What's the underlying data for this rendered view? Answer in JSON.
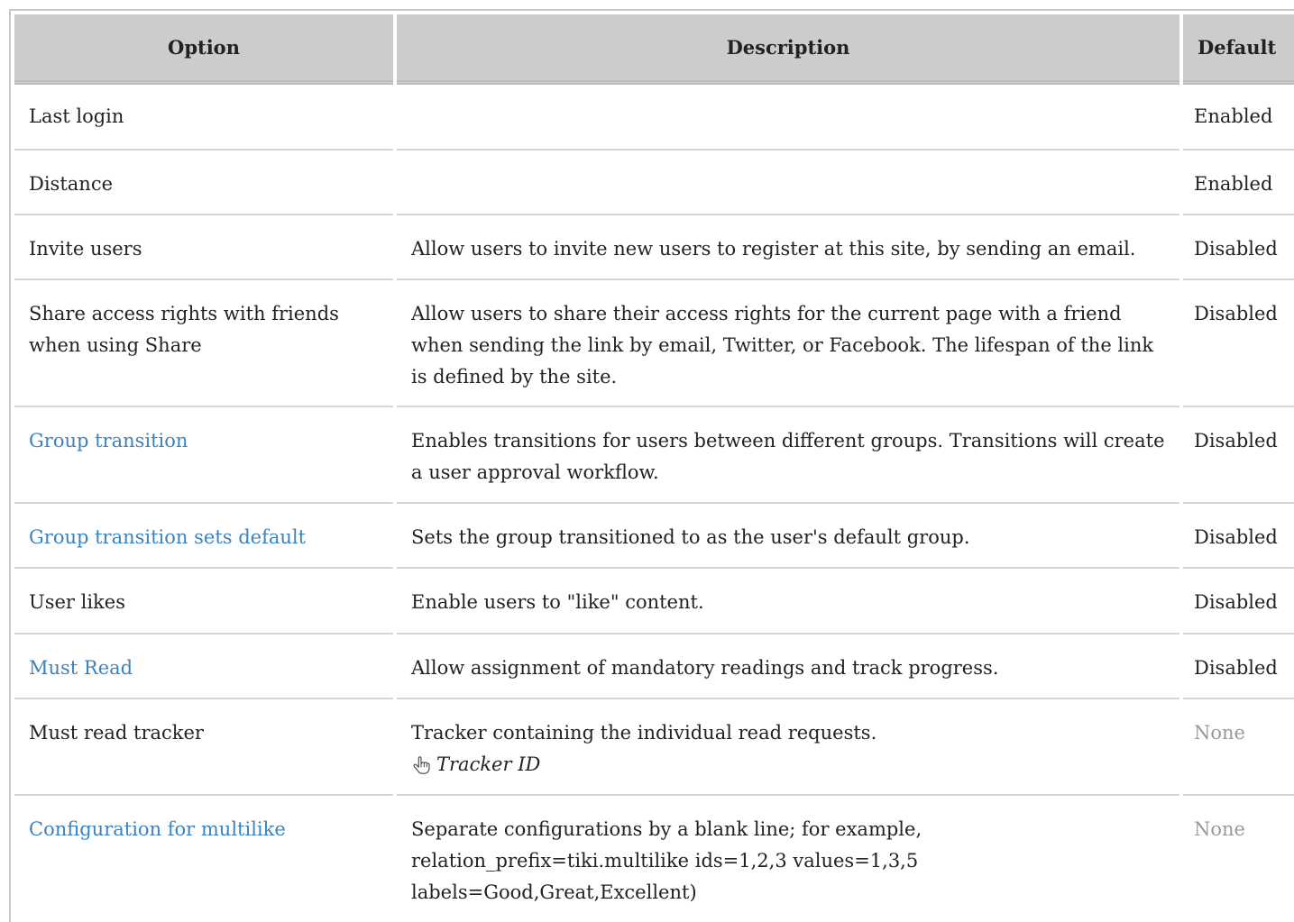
{
  "table": {
    "headers": {
      "option": "Option",
      "description": "Description",
      "default": "Default"
    },
    "rows": [
      {
        "option": "Last login",
        "option_link": false,
        "description": "",
        "default": "Enabled",
        "default_muted": false
      },
      {
        "option": "Distance",
        "option_link": false,
        "description": "",
        "default": "Enabled",
        "default_muted": false
      },
      {
        "option": "Invite users",
        "option_link": false,
        "description": "Allow users to invite new users to register at this site, by sending an email.",
        "default": "Disabled",
        "default_muted": false
      },
      {
        "option": "Share access rights with friends when using Share",
        "option_link": false,
        "description": "Allow users to share their access rights for the current page with a friend when sending the link by email, Twitter, or Facebook. The lifespan of the link is defined by the site.",
        "default": "Disabled",
        "default_muted": false
      },
      {
        "option": "Group transition",
        "option_link": true,
        "description": "Enables transitions for users between different groups. Transitions will create a user approval workflow.",
        "default": "Disabled",
        "default_muted": false
      },
      {
        "option": "Group transition sets default",
        "option_link": true,
        "description": "Sets the group transitioned to as the user's default group.",
        "default": "Disabled",
        "default_muted": false
      },
      {
        "option": "User likes",
        "option_link": false,
        "description": "Enable users to \"like\" content.",
        "default": "Disabled",
        "default_muted": false
      },
      {
        "option": "Must Read",
        "option_link": true,
        "description": "Allow assignment of mandatory readings and track progress.",
        "default": "Disabled",
        "default_muted": false
      },
      {
        "option": "Must read tracker",
        "option_link": false,
        "description": "Tracker containing the individual read requests.",
        "hint": "Tracker ID",
        "hint_icon": "pointing-hand-icon",
        "default": "None",
        "default_muted": true
      },
      {
        "option": "Configuration for multilike",
        "option_link": true,
        "description": "Separate configurations by a blank line; for example, relation_prefix=tiki.multilike ids=1,2,3 values=1,3,5 labels=Good,Great,Excellent)",
        "default": "None",
        "default_muted": true
      }
    ]
  },
  "colors": {
    "link": "#3c83bd",
    "header_bg": "#cccccc",
    "muted": "#9a9a9a"
  }
}
